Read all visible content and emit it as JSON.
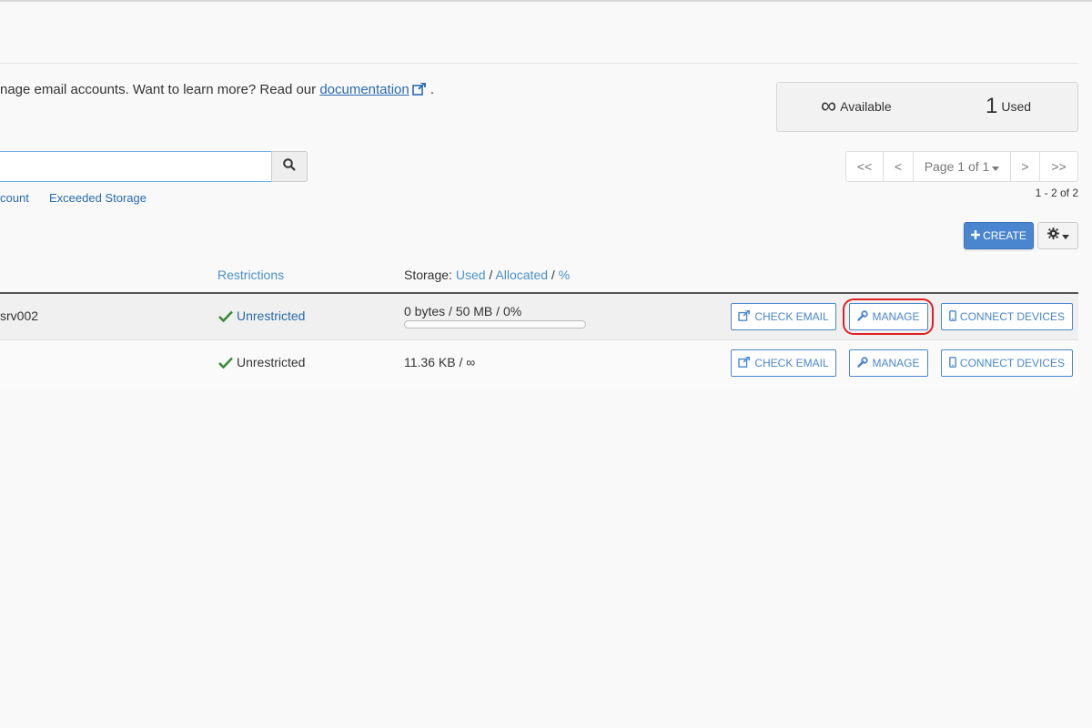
{
  "intro": {
    "text_before": "nage email accounts. Want to learn more? Read our ",
    "link_label": "documentation",
    "text_after": " ."
  },
  "stats": {
    "available_value": "∞",
    "available_label": "Available",
    "used_value": "1",
    "used_label": "Used"
  },
  "search": {
    "value": "",
    "placeholder": ""
  },
  "filters": [
    {
      "label": "count"
    },
    {
      "label": "Exceeded Storage"
    }
  ],
  "pagination": {
    "first": "<<",
    "prev": "<",
    "page": "Page 1 of 1",
    "next": ">",
    "last": ">>",
    "range": "1 - 2 of 2"
  },
  "toolbar": {
    "create_label": "CREATE"
  },
  "table": {
    "headers": {
      "restrictions": "Restrictions",
      "storage_prefix": "Storage: ",
      "storage_used": "Used",
      "storage_sep1": " / ",
      "storage_allocated": "Allocated",
      "storage_sep2": " / ",
      "storage_percent": "%"
    },
    "rows": [
      {
        "account": "srv002",
        "restriction": "Unrestricted",
        "storage": "0 bytes / 50 MB / 0%",
        "progress_percent": 0,
        "check_email": "CHECK EMAIL",
        "manage": "MANAGE",
        "connect": "CONNECT DEVICES"
      },
      {
        "account": "",
        "restriction": "Unrestricted",
        "storage": "11.36 KB / ∞",
        "check_email": "CHECK EMAIL",
        "manage": "MANAGE",
        "connect": "CONNECT DEVICES"
      }
    ]
  },
  "colors": {
    "accent": "#4a86cf",
    "link": "#2a6aad",
    "success": "#3a8a3a",
    "highlight": "#e02020"
  }
}
